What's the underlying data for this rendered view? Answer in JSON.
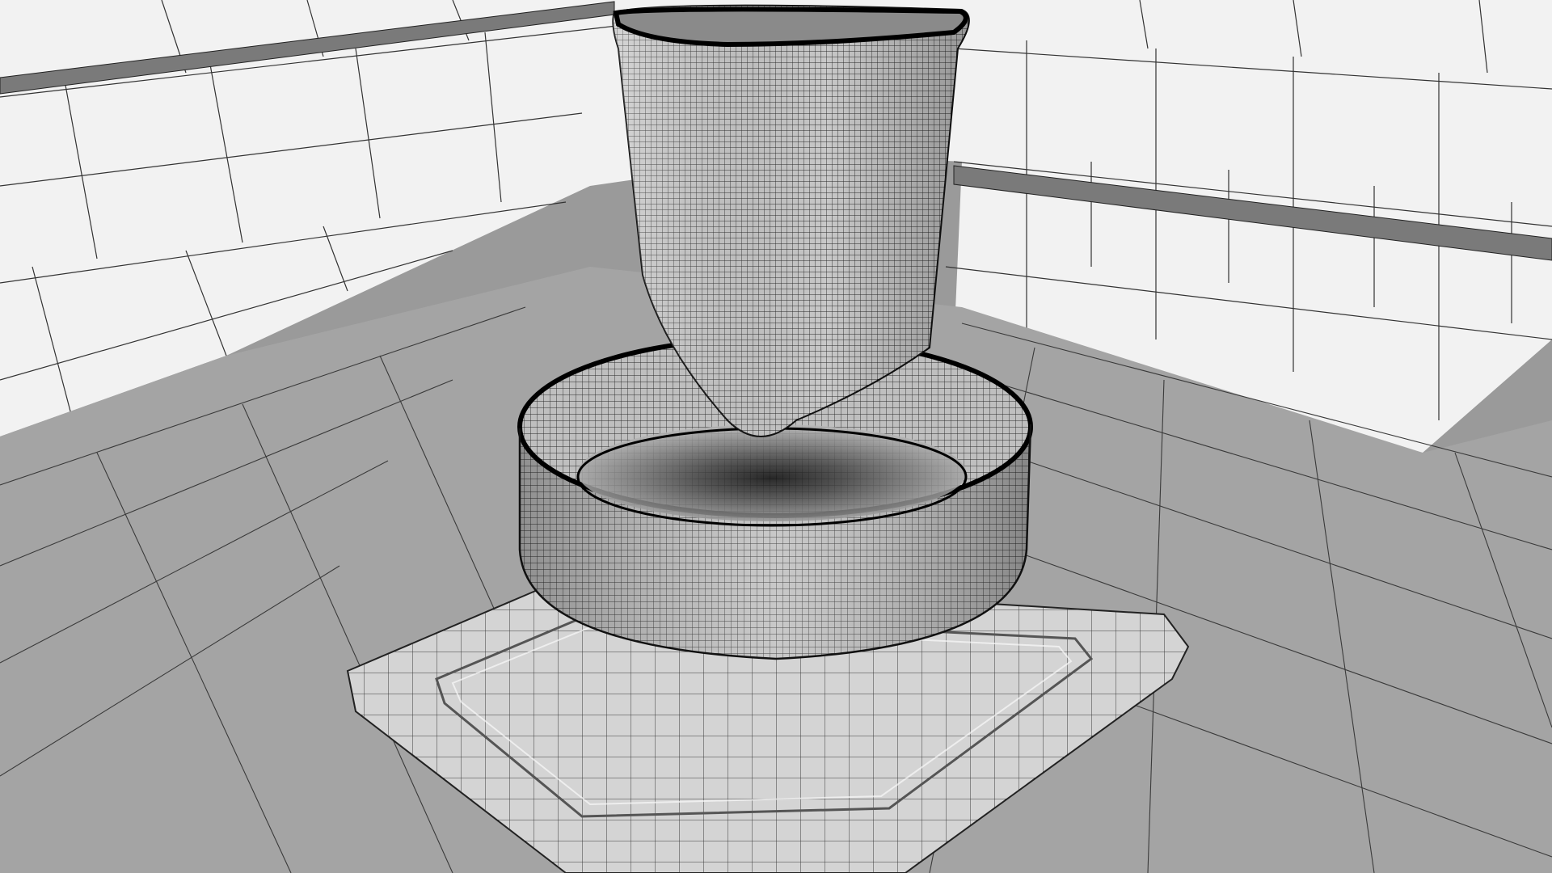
{
  "scene": {
    "kind": "3d-wireframe-render",
    "objects": [
      {
        "name": "triangular-vase",
        "mesh": "dense-quad-wireframe"
      },
      {
        "name": "round-bowl",
        "mesh": "dense-quad-wireframe"
      },
      {
        "name": "square-tray",
        "mesh": "coarse-quad-wireframe"
      }
    ],
    "environment": [
      "tiled-back-wall",
      "tiled-floor",
      "wall-rail"
    ],
    "colors": {
      "wall_tile": "#f2f2f2",
      "floor_tile": "#a4a4a4",
      "rail": "#7a7a7a",
      "mesh_line": "#1a1a1a",
      "mesh_fill": "#bdbdbd",
      "tray_fill": "#cfcfcf"
    }
  }
}
